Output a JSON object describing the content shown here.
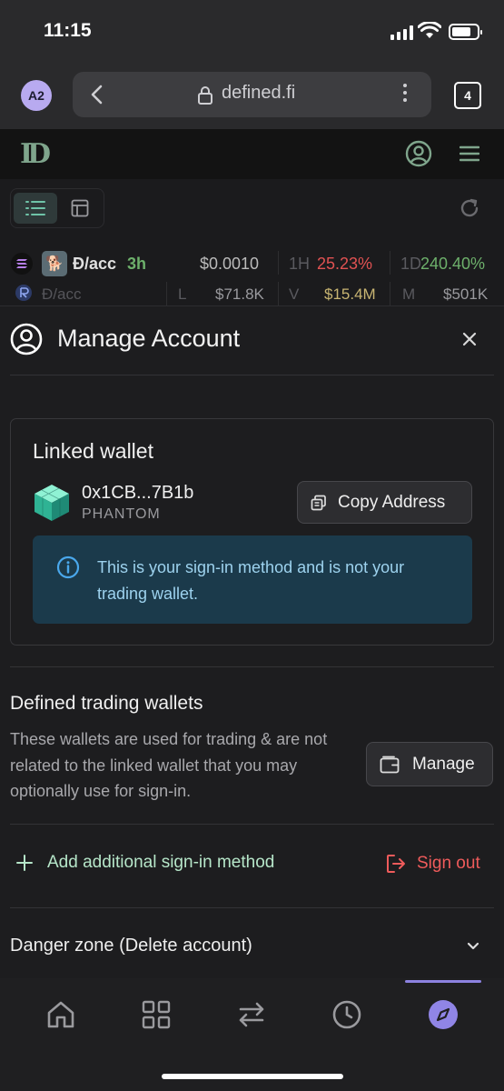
{
  "status_bar": {
    "time": "11:15"
  },
  "browser": {
    "profile": "A2",
    "url": "defined.fi",
    "tab_count": "4"
  },
  "app_header": {
    "logo": "ID"
  },
  "token_row": {
    "name": "Đ/acc",
    "age": "3h",
    "price": "$0.0010",
    "h1_label": "1H",
    "h1_value": "25.23%",
    "d1_label": "1D",
    "d1_value": "240.40%",
    "sub_name": "Đ/acc",
    "liq_label": "L",
    "liq_value": "$71.8K",
    "vol_label": "V",
    "vol_value": "$15.4M",
    "mcap_label": "M",
    "mcap_value": "$501K"
  },
  "modal": {
    "title": "Manage Account",
    "linked_wallet": {
      "title": "Linked wallet",
      "address": "0x1CB...7B1b",
      "wallet_type": "PHANTOM",
      "copy_label": "Copy Address",
      "info_text": "This is your sign-in method and is not your trading wallet."
    },
    "trading_wallets": {
      "title": "Defined trading wallets",
      "description": "These wallets are used for trading & are not related to the linked wallet that you may optionally use for sign-in.",
      "manage_label": "Manage"
    },
    "add_signin_label": "Add additional sign-in method",
    "sign_out_label": "Sign out",
    "danger_zone_label": "Danger zone (Delete account)"
  },
  "bottom_nav": {
    "items": [
      "home-icon",
      "grid-icon",
      "swap-icon",
      "clock-icon",
      "compass-icon"
    ],
    "active": "compass-icon"
  },
  "colors": {
    "accent_purple": "#8c82e0",
    "positive": "#6db06b",
    "negative": "#e05252",
    "info_bg": "#1b3a4b"
  }
}
